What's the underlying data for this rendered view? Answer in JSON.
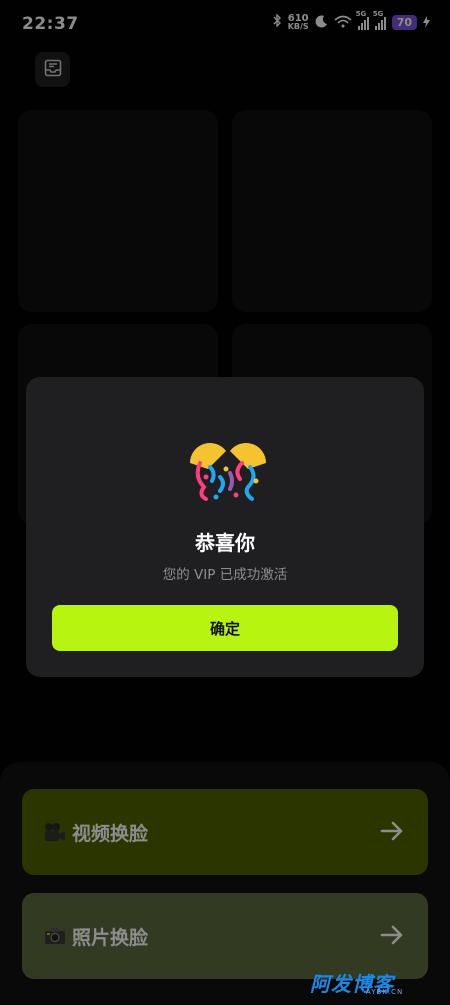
{
  "status_bar": {
    "time": "22:37",
    "net_speed_value": "610",
    "net_speed_unit": "KB/S",
    "signal_1_label": "5G",
    "signal_2_label": "5G",
    "battery": "70",
    "icons": [
      "bluetooth-icon",
      "moon-icon",
      "wifi-icon",
      "signal-icon",
      "signal-icon",
      "battery-icon",
      "charging-icon"
    ]
  },
  "header": {
    "inbox_icon": "inbox-icon"
  },
  "modal": {
    "art_icon": "party-celebration-icon",
    "title": "恭喜你",
    "subtitle": "您的 VIP 已成功激活",
    "confirm_label": "确定"
  },
  "actions": [
    {
      "label": "视频换脸",
      "icon": "movie-camera-icon",
      "color": "#4e6100"
    },
    {
      "label": "照片换脸",
      "icon": "camera-icon",
      "color": "#5b6b3f"
    }
  ],
  "colors": {
    "accent": "#b7f40f",
    "modal_bg": "#1f1f22",
    "battery": "#7b52d9"
  },
  "watermark": {
    "main": "阿发博客",
    "sub": "AYBK.CN"
  }
}
